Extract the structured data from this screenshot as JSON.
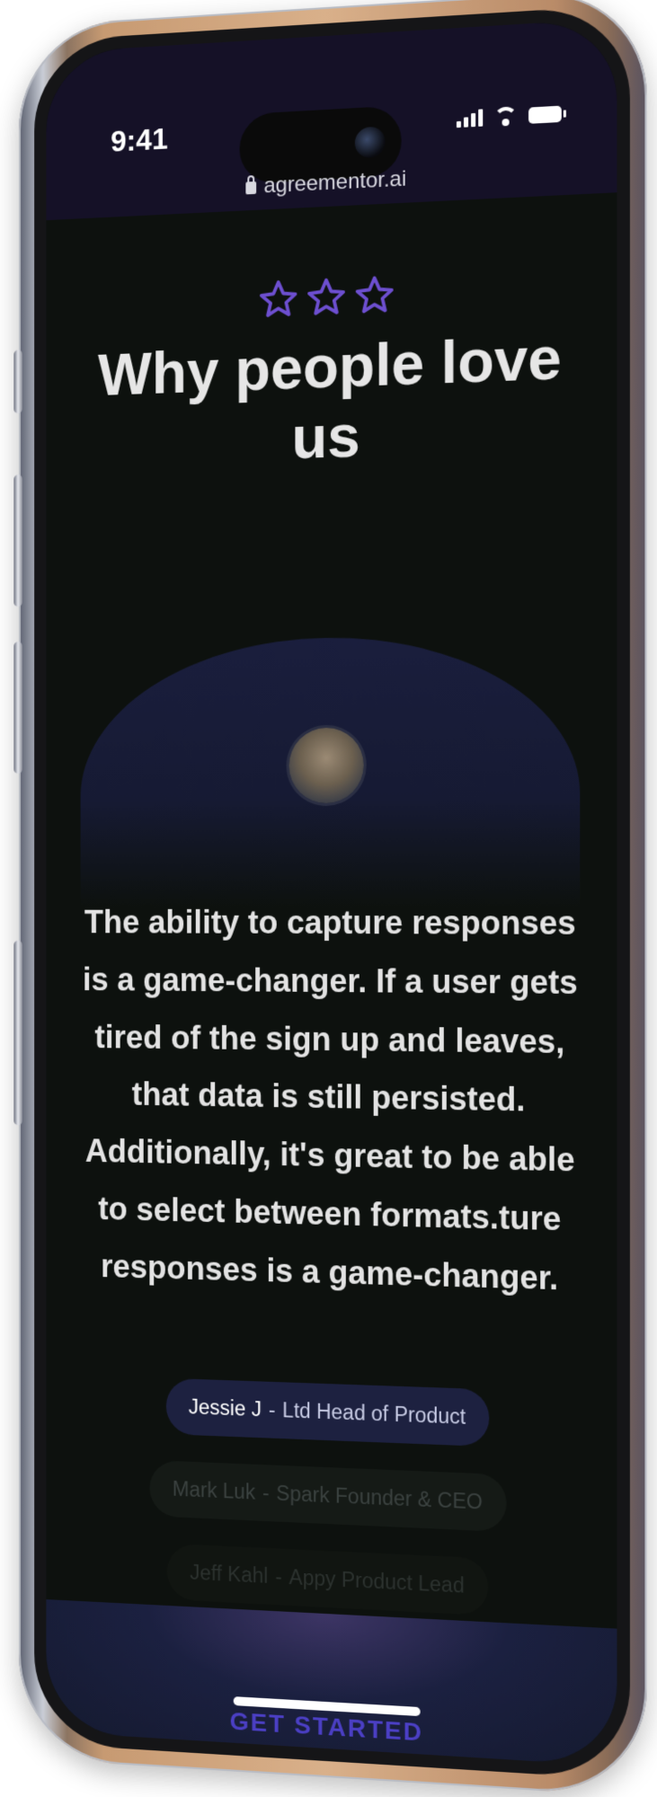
{
  "status_bar": {
    "time": "9:41"
  },
  "browser": {
    "url": "agreementor.ai"
  },
  "section": {
    "heading": "Why people love us",
    "rating_stars": 3,
    "star_color": "#6d4fd0"
  },
  "testimonial": {
    "quote": "The ability to capture responses is a game-changer. If a user gets tired of the sign up and leaves, that data is still persisted. Additionally, it's great to be able to select between formats.ture responses is a game-changer."
  },
  "people": [
    {
      "name": "Jessie J",
      "separator": "-",
      "role": "Ltd Head of Product",
      "active": true
    },
    {
      "name": "Mark Luk",
      "separator": "-",
      "role": "Spark Founder & CEO",
      "active": false
    },
    {
      "name": "Jeff Kahl",
      "separator": "-",
      "role": "Appy Product Lead",
      "active": false
    }
  ],
  "footer": {
    "cta_label": "GET STARTED"
  },
  "colors": {
    "screen_background": "#0d110e",
    "header_background": "#151127",
    "accent": "#4b3fc4"
  }
}
